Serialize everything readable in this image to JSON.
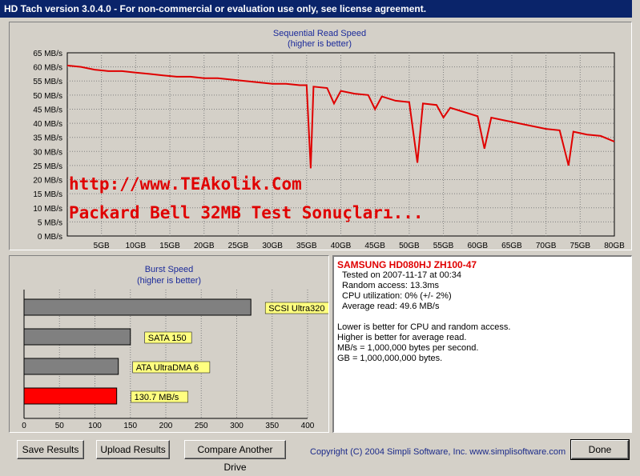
{
  "window": {
    "title": "HD Tach version 3.0.4.0  - For non-commercial or evaluation use only, see license agreement."
  },
  "sequential": {
    "title": "Sequential Read Speed",
    "subtitle": "(higher is better)",
    "y_tick_labels": [
      "65 MB/s",
      "60 MB/s",
      "55 MB/s",
      "50 MB/s",
      "45 MB/s",
      "40 MB/s",
      "35 MB/s",
      "30 MB/s",
      "25 MB/s",
      "20 MB/s",
      "15 MB/s",
      "10 MB/s",
      "5 MB/s",
      "0 MB/s"
    ],
    "x_tick_labels": [
      "5GB",
      "10GB",
      "15GB",
      "20GB",
      "25GB",
      "30GB",
      "35GB",
      "40GB",
      "45GB",
      "50GB",
      "55GB",
      "60GB",
      "65GB",
      "70GB",
      "75GB",
      "80GB"
    ],
    "line_color": "#e00000"
  },
  "watermark": {
    "line1": "http://www.TEAkolik.Com",
    "line2": "Packard Bell 32MB Test Sonuçları..."
  },
  "burst": {
    "title": "Burst Speed",
    "subtitle": "(higher is better)",
    "x_tick_labels": [
      "0",
      "50",
      "100",
      "150",
      "200",
      "250",
      "300",
      "350",
      "400"
    ]
  },
  "drive_info": {
    "name": "SAMSUNG HD080HJ ZH100-47",
    "lines": [
      "Tested on 2007-11-17 at 00:34",
      "Random access: 13.3ms",
      "CPU utilization: 0% (+/- 2%)",
      "Average read: 49.6 MB/s"
    ],
    "notes": [
      "Lower is better for CPU and random access.",
      "Higher is better for average read.",
      "MB/s = 1,000,000 bytes per second.",
      "GB = 1,000,000,000 bytes."
    ]
  },
  "buttons": {
    "save": "Save Results",
    "upload": "Upload Results",
    "compare": "Compare Another Drive",
    "done": "Done"
  },
  "copyright": "Copyright (C) 2004 Simpli Software, Inc. www.simplisoftware.com",
  "chart_data": [
    {
      "type": "line",
      "title": "Sequential Read Speed",
      "subtitle": "(higher is better)",
      "xlabel": "",
      "ylabel": "",
      "x_unit": "GB",
      "y_unit": "MB/s",
      "xlim": [
        0,
        80
      ],
      "ylim": [
        0,
        65
      ],
      "grid": true,
      "series": [
        {
          "x": [
            0,
            2,
            4,
            6,
            8,
            10,
            12,
            14,
            16,
            18,
            20,
            22,
            24,
            26,
            28,
            30,
            32,
            34,
            35,
            35.6,
            36,
            38,
            39,
            40,
            42,
            44,
            45,
            46,
            48,
            50,
            51.2,
            52,
            54,
            55,
            56,
            58,
            60,
            61,
            62,
            64,
            66,
            68,
            70,
            72,
            73.3,
            74,
            76,
            78,
            80
          ],
          "y": [
            60.5,
            60,
            59,
            58.5,
            58.5,
            58,
            57.5,
            57,
            56.5,
            56.5,
            56,
            56,
            55.5,
            55,
            54.5,
            54,
            54,
            53.5,
            53.5,
            24,
            53,
            52.5,
            47,
            51.5,
            50.5,
            50,
            45,
            49.5,
            48,
            47.5,
            26,
            47,
            46.5,
            42,
            45.5,
            44,
            42.5,
            31,
            42,
            41,
            40,
            39,
            38,
            37.5,
            25,
            37,
            36,
            35.5,
            33.5
          ]
        }
      ]
    },
    {
      "type": "bar",
      "title": "Burst Speed",
      "subtitle": "(higher is better)",
      "xlim": [
        0,
        400
      ],
      "grid": true,
      "categories": [
        "SCSI Ultra320",
        "SATA 150",
        "ATA UltraDMA 6",
        "130.7 MB/s"
      ],
      "values": [
        320,
        150,
        133,
        130.7
      ],
      "colors": [
        "#808080",
        "#808080",
        "#808080",
        "#ff0000"
      ],
      "label_color": "#ffff80"
    }
  ]
}
